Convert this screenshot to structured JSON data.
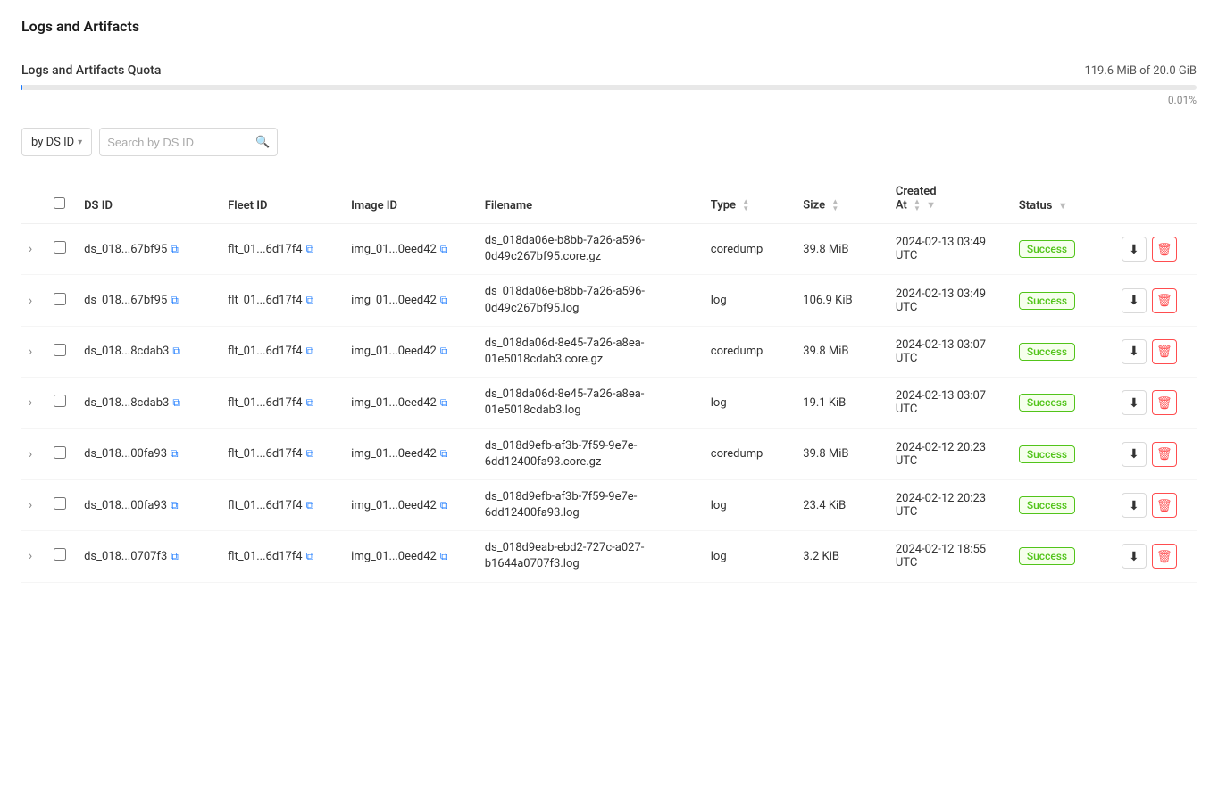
{
  "page": {
    "title": "Logs and Artifacts"
  },
  "quota": {
    "label": "Logs and Artifacts Quota",
    "value": "119.6 MiB of 20.0 GiB",
    "percent": "0.01%",
    "fill_width": "0.01%"
  },
  "filter": {
    "dropdown_label": "by DS ID",
    "search_placeholder": "Search by DS ID"
  },
  "table": {
    "columns": [
      {
        "key": "dsid",
        "label": "DS ID"
      },
      {
        "key": "fleetid",
        "label": "Fleet ID"
      },
      {
        "key": "imageid",
        "label": "Image ID"
      },
      {
        "key": "filename",
        "label": "Filename"
      },
      {
        "key": "type",
        "label": "Type"
      },
      {
        "key": "size",
        "label": "Size"
      },
      {
        "key": "created",
        "label": "Created\nAt"
      },
      {
        "key": "status",
        "label": "Status"
      }
    ],
    "rows": [
      {
        "dsid": "ds_018...67bf95",
        "fleetid": "flt_01...6d17f4",
        "imageid": "img_01...0eed42",
        "filename": "ds_018da06e-b8bb-7a26-a596-0d49c267bf95.core.gz",
        "type": "coredump",
        "size": "39.8 MiB",
        "created": "2024-02-13 03:49 UTC",
        "status": "Success"
      },
      {
        "dsid": "ds_018...67bf95",
        "fleetid": "flt_01...6d17f4",
        "imageid": "img_01...0eed42",
        "filename": "ds_018da06e-b8bb-7a26-a596-0d49c267bf95.log",
        "type": "log",
        "size": "106.9 KiB",
        "created": "2024-02-13 03:49 UTC",
        "status": "Success"
      },
      {
        "dsid": "ds_018...8cdab3",
        "fleetid": "flt_01...6d17f4",
        "imageid": "img_01...0eed42",
        "filename": "ds_018da06d-8e45-7a26-a8ea-01e5018cdab3.core.gz",
        "type": "coredump",
        "size": "39.8 MiB",
        "created": "2024-02-13 03:07 UTC",
        "status": "Success"
      },
      {
        "dsid": "ds_018...8cdab3",
        "fleetid": "flt_01...6d17f4",
        "imageid": "img_01...0eed42",
        "filename": "ds_018da06d-8e45-7a26-a8ea-01e5018cdab3.log",
        "type": "log",
        "size": "19.1 KiB",
        "created": "2024-02-13 03:07 UTC",
        "status": "Success"
      },
      {
        "dsid": "ds_018...00fa93",
        "fleetid": "flt_01...6d17f4",
        "imageid": "img_01...0eed42",
        "filename": "ds_018d9efb-af3b-7f59-9e7e-6dd12400fa93.core.gz",
        "type": "coredump",
        "size": "39.8 MiB",
        "created": "2024-02-12 20:23 UTC",
        "status": "Success"
      },
      {
        "dsid": "ds_018...00fa93",
        "fleetid": "flt_01...6d17f4",
        "imageid": "img_01...0eed42",
        "filename": "ds_018d9efb-af3b-7f59-9e7e-6dd12400fa93.log",
        "type": "log",
        "size": "23.4 KiB",
        "created": "2024-02-12 20:23 UTC",
        "status": "Success"
      },
      {
        "dsid": "ds_018...0707f3",
        "fleetid": "flt_01...6d17f4",
        "imageid": "img_01...0eed42",
        "filename": "ds_018d9eab-ebd2-727c-a027-b1644a0707f3.log",
        "type": "log",
        "size": "3.2 KiB",
        "created": "2024-02-12 18:55 UTC",
        "status": "Success"
      }
    ]
  },
  "icons": {
    "chevron_down": "▾",
    "search": "🔍",
    "external_link": "⧉",
    "sort_asc": "▲",
    "sort_desc": "▼",
    "filter": "⊟",
    "download": "⬇",
    "delete": "🗑",
    "expand": "›"
  }
}
